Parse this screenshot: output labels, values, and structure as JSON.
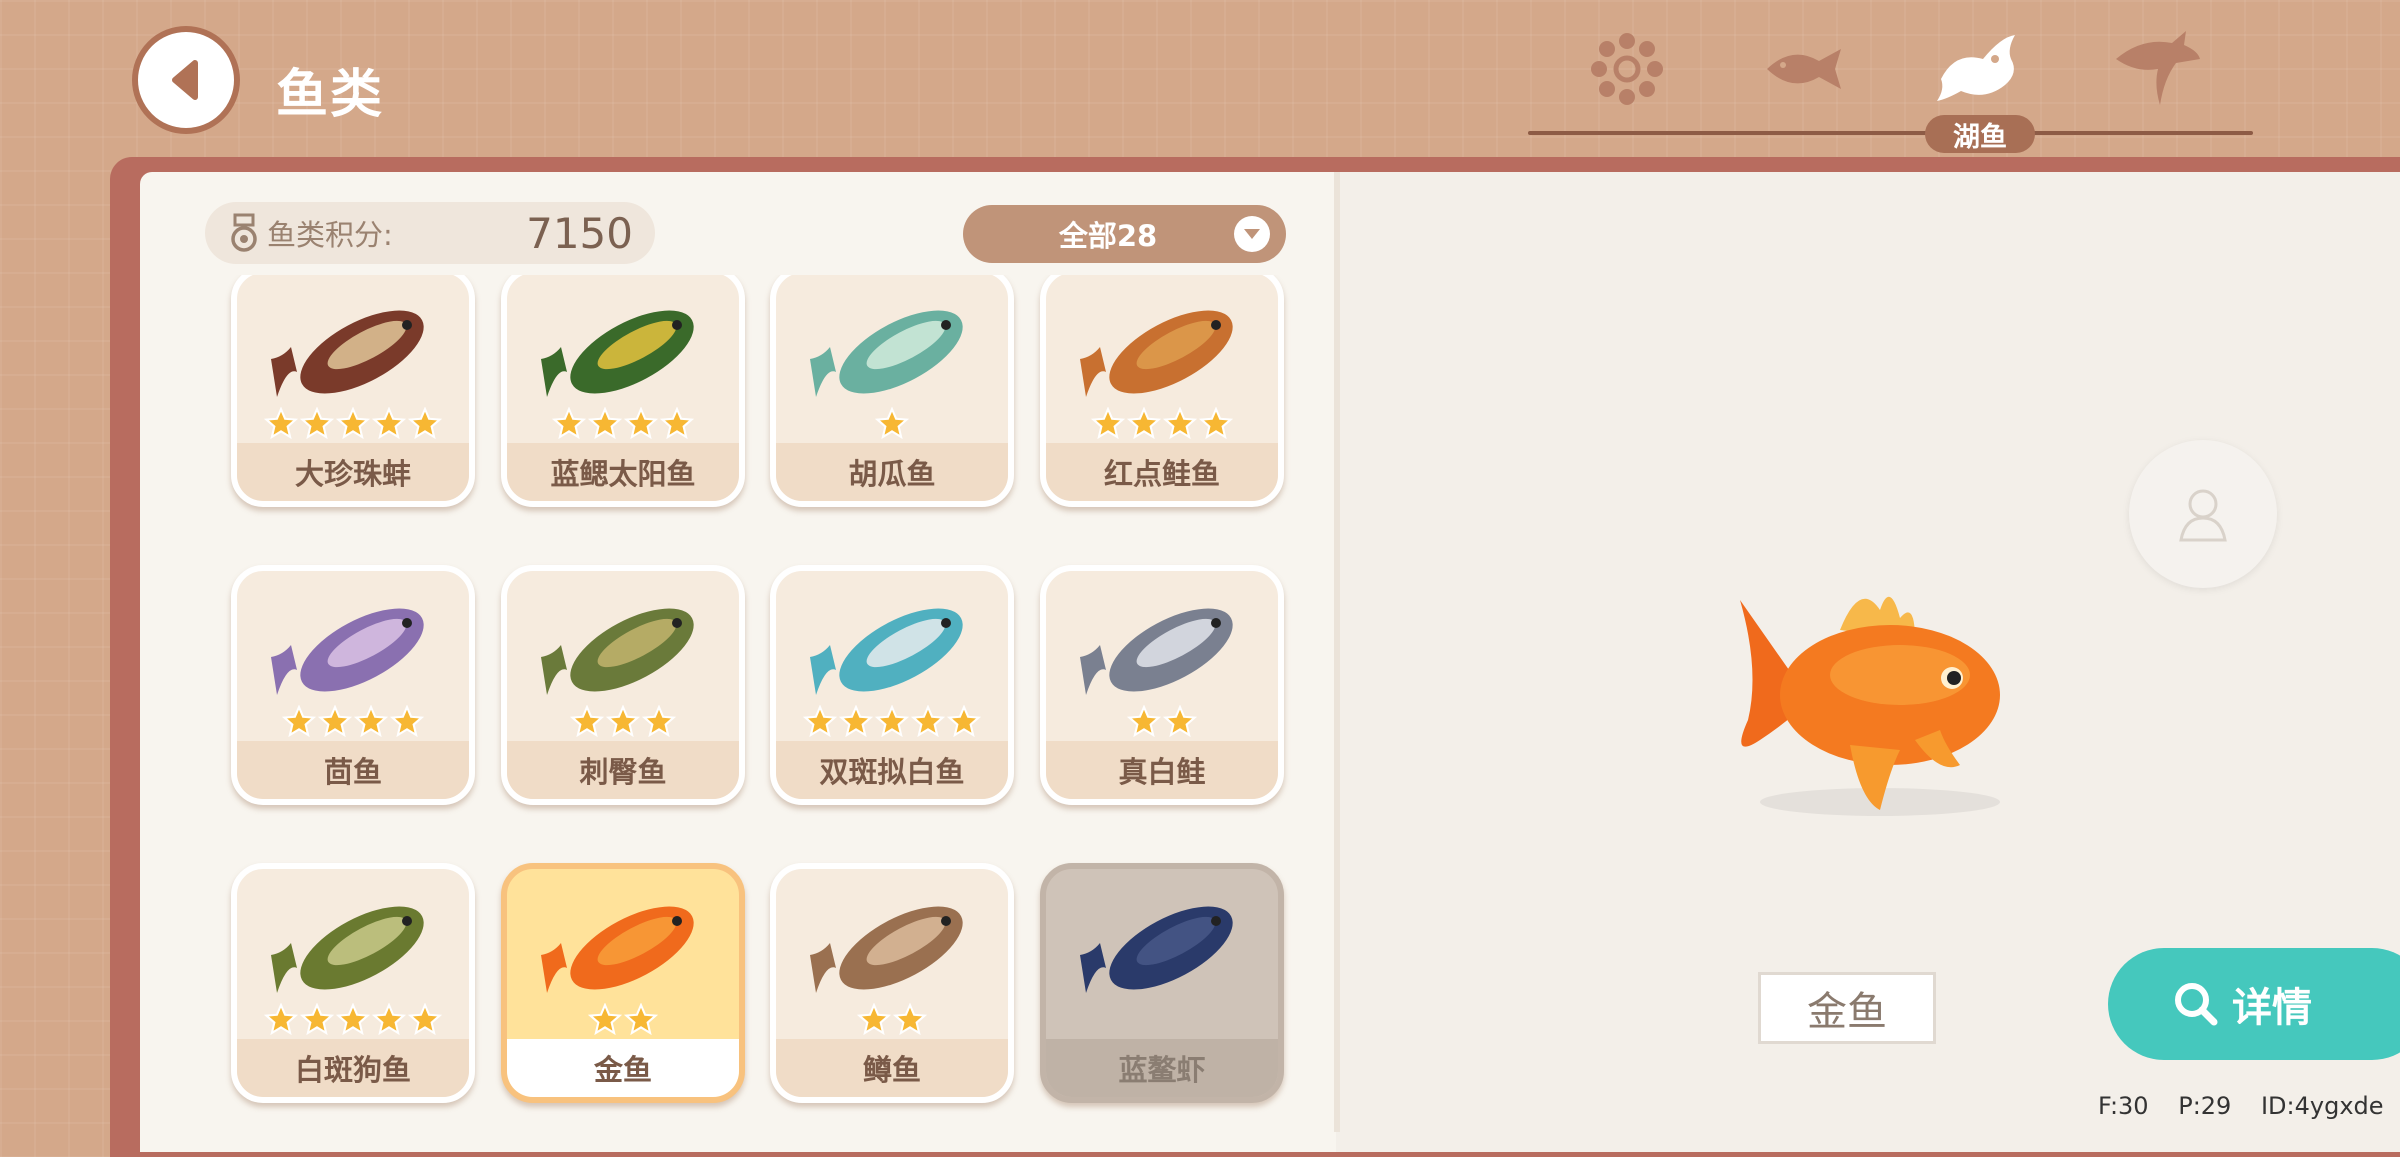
{
  "header": {
    "title": "鱼类",
    "tabs": [
      "all-icon",
      "fish-icon",
      "lake-fish-icon",
      "shark-icon"
    ],
    "active_tab_label": "湖鱼"
  },
  "score": {
    "label": "鱼类积分:",
    "value": "7150"
  },
  "filter": {
    "label": "全部28"
  },
  "fish": [
    {
      "name": "大珍珠蚌",
      "stars": 5,
      "state": "normal"
    },
    {
      "name": "蓝鳃太阳鱼",
      "stars": 4,
      "state": "normal"
    },
    {
      "name": "胡瓜鱼",
      "stars": 1,
      "state": "normal"
    },
    {
      "name": "红点鲑鱼",
      "stars": 4,
      "state": "normal"
    },
    {
      "name": "茴鱼",
      "stars": 4,
      "state": "normal"
    },
    {
      "name": "刺臀鱼",
      "stars": 3,
      "state": "normal"
    },
    {
      "name": "双斑拟白鱼",
      "stars": 5,
      "state": "normal"
    },
    {
      "name": "真白鲑",
      "stars": 2,
      "state": "normal"
    },
    {
      "name": "白斑狗鱼",
      "stars": 5,
      "state": "normal"
    },
    {
      "name": "金鱼",
      "stars": 2,
      "state": "selected"
    },
    {
      "name": "鳟鱼",
      "stars": 2,
      "state": "normal"
    },
    {
      "name": "蓝鳌虾",
      "stars": 0,
      "state": "locked"
    }
  ],
  "detail": {
    "name": "金鱼",
    "button_label": "详情"
  },
  "debug": {
    "f": "F:30",
    "p": "P:29",
    "id": "ID:4ygxde"
  },
  "colors": {
    "accent": "#45c8bd",
    "star": "#f7b733",
    "book": "#b86c5f"
  }
}
